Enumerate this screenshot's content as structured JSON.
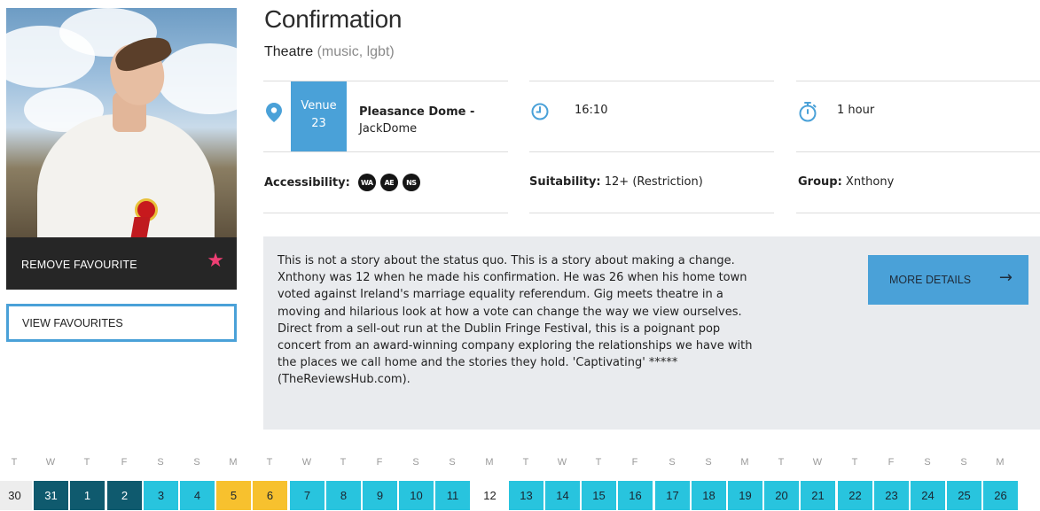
{
  "event": {
    "title": "Confirmation",
    "category": "Theatre",
    "tags": "(music, lgbt)"
  },
  "sidebar": {
    "remove_favourite_label": "REMOVE FAVOURITE",
    "view_favourites_label": "VIEW FAVOURITES",
    "star_color": "#ef3f74"
  },
  "details": {
    "venue_label": "Venue",
    "venue_number": "23",
    "venue_name": "Pleasance Dome -",
    "venue_sub": "JackDome",
    "time": "16:10",
    "duration": "1 hour",
    "accessibility_label": "Accessibility:",
    "accessibility_badges": [
      "WA",
      "AE",
      "NS"
    ],
    "suitability_label": "Suitability:",
    "suitability_value": "12+ (Restriction)",
    "group_label": "Group:",
    "group_value": "Xnthony"
  },
  "description": {
    "lines": [
      "This is not a story about the status quo. This is a story about making a change.",
      "Xnthony was 12 when he made his confirmation. He was 26 when his home town",
      "voted against Ireland's marriage equality referendum. Gig meets theatre in a",
      "moving and hilarious look at how a vote can change the way we view ourselves.",
      "Direct from a sell-out run at the Dublin Fringe Festival, this is a poignant pop",
      "concert from an award-winning company exploring the relationships we have with",
      "the places we call home and the stories they hold. 'Captivating' *****",
      "(TheReviewsHub.com)."
    ],
    "more_details_label": "MORE DETAILS",
    "accent_color": "#4aa1d8"
  },
  "calendar": {
    "days": [
      {
        "letter": "T",
        "date": "30",
        "state": "inactive"
      },
      {
        "letter": "W",
        "date": "31",
        "state": "past"
      },
      {
        "letter": "T",
        "date": "1",
        "state": "past"
      },
      {
        "letter": "F",
        "date": "2",
        "state": "past"
      },
      {
        "letter": "S",
        "date": "3",
        "state": "available"
      },
      {
        "letter": "S",
        "date": "4",
        "state": "available"
      },
      {
        "letter": "M",
        "date": "5",
        "state": "preview"
      },
      {
        "letter": "T",
        "date": "6",
        "state": "preview"
      },
      {
        "letter": "W",
        "date": "7",
        "state": "available"
      },
      {
        "letter": "T",
        "date": "8",
        "state": "available"
      },
      {
        "letter": "F",
        "date": "9",
        "state": "available"
      },
      {
        "letter": "S",
        "date": "10",
        "state": "available"
      },
      {
        "letter": "S",
        "date": "11",
        "state": "available"
      },
      {
        "letter": "M",
        "date": "12",
        "state": "none"
      },
      {
        "letter": "T",
        "date": "13",
        "state": "available"
      },
      {
        "letter": "W",
        "date": "14",
        "state": "available"
      },
      {
        "letter": "T",
        "date": "15",
        "state": "available"
      },
      {
        "letter": "F",
        "date": "16",
        "state": "available"
      },
      {
        "letter": "S",
        "date": "17",
        "state": "available"
      },
      {
        "letter": "S",
        "date": "18",
        "state": "available"
      },
      {
        "letter": "M",
        "date": "19",
        "state": "available"
      },
      {
        "letter": "T",
        "date": "20",
        "state": "available"
      },
      {
        "letter": "W",
        "date": "21",
        "state": "available"
      },
      {
        "letter": "T",
        "date": "22",
        "state": "available"
      },
      {
        "letter": "F",
        "date": "23",
        "state": "available"
      },
      {
        "letter": "S",
        "date": "24",
        "state": "available"
      },
      {
        "letter": "S",
        "date": "25",
        "state": "available"
      },
      {
        "letter": "M",
        "date": "26",
        "state": "available"
      }
    ],
    "colors": {
      "past": "#0f5a6e",
      "available": "#28c4de",
      "preview": "#f7c12e",
      "inactive": "#ededed"
    }
  }
}
